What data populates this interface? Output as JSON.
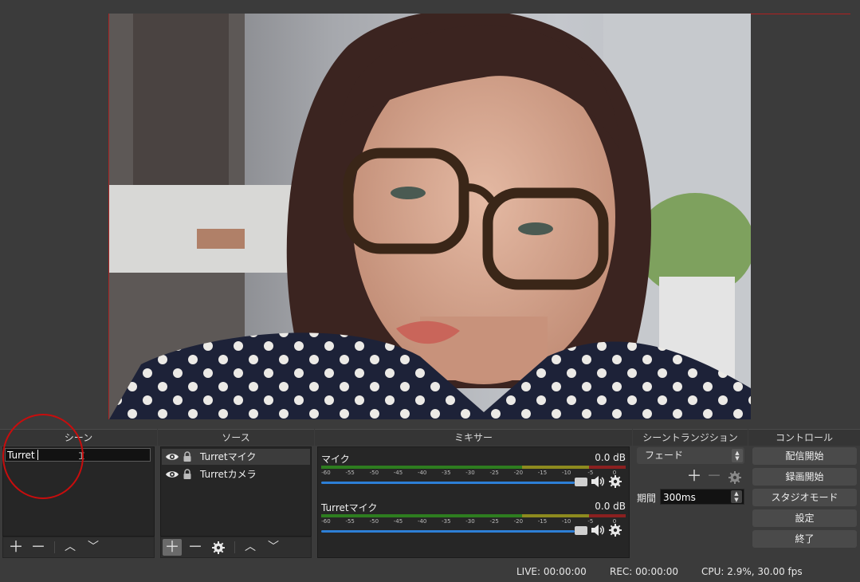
{
  "docks": {
    "scenes": {
      "title": "シーン",
      "rename_value": "Turret"
    },
    "sources": {
      "title": "ソース",
      "items": [
        {
          "label": "Turretマイク"
        },
        {
          "label": "Turretカメラ"
        }
      ]
    },
    "mixer": {
      "title": "ミキサー",
      "channels": [
        {
          "name": "マイク",
          "db": "0.0 dB"
        },
        {
          "name": "Turretマイク",
          "db": "0.0 dB"
        }
      ],
      "ticks": [
        "-60",
        "-55",
        "-50",
        "-45",
        "-40",
        "-35",
        "-30",
        "-25",
        "-20",
        "-15",
        "-10",
        "-5",
        "0"
      ]
    },
    "transitions": {
      "title": "シーントランジション",
      "selected": "フェード",
      "duration_label": "期間",
      "duration_value": "300ms"
    },
    "controls": {
      "title": "コントロール",
      "buttons": [
        "配信開始",
        "録画開始",
        "スタジオモード",
        "設定",
        "終了"
      ]
    }
  },
  "status": {
    "live": "LIVE: 00:00:00",
    "rec": "REC: 00:00:00",
    "cpu": "CPU: 2.9%, 30.00 fps"
  },
  "colors": {
    "annotation": "#c80d0d",
    "fader": "#2d7fd6"
  }
}
